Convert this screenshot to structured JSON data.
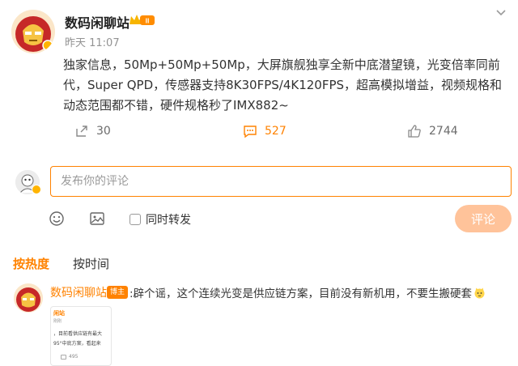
{
  "post": {
    "author": "数码闲聊站",
    "crown_level": "Ⅲ",
    "time": "昨天 11:07",
    "body": "独家信息，50Mp+50Mp+50Mp，大屏旗舰独享全新中底潜望镜，光变倍率同前代，Super QPD，传感器支持8K30FPS/4K120FPS，超高模拟增益，视频规格和动态范围都不错，硬件规格秒了IMX882~",
    "repost_count": "30",
    "comment_count": "527",
    "like_count": "2744"
  },
  "reply_box": {
    "placeholder": "发布你的评论",
    "also_repost_label": "同时转发",
    "submit_label": "评论"
  },
  "sort_tabs": {
    "hot": "按热度",
    "time": "按时间"
  },
  "comment": {
    "author": "数码闲聊站",
    "badge": "博主",
    "text": ":辟个谣，这个连续光变是供应链方案，目前没有新机用，不要生搬硬套",
    "image_lines": [
      "闲站",
      "刚刚",
      "，目前看供应链有最大",
      "95°中底方案，看起来",
      "495"
    ]
  },
  "colors": {
    "accent": "#ff8200",
    "submit_disabled": "#ffc39a",
    "muted": "#939393"
  },
  "icons": [
    "more-icon",
    "crown-badge-icon",
    "repost-icon",
    "comment-icon",
    "like-icon",
    "emoji-icon",
    "image-icon",
    "vip-badge-icon",
    "cat-emoji-icon"
  ]
}
